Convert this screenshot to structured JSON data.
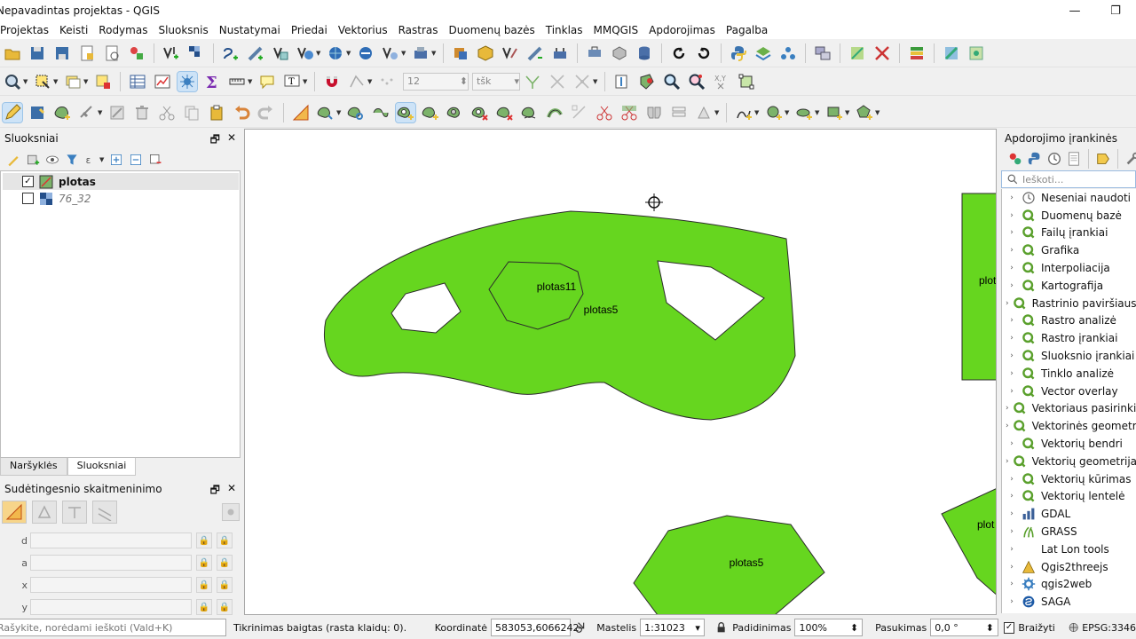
{
  "window": {
    "title": "Nepavadintas projektas - QGIS",
    "minimize": "—",
    "maximize": "❐"
  },
  "menu": [
    "Projektas",
    "Keisti",
    "Rodymas",
    "Sluoksnis",
    "Nustatymai",
    "Priedai",
    "Vektorius",
    "Rastras",
    "Duomenų bazės",
    "Tinklas",
    "MMQGIS",
    "Apdorojimas",
    "Pagalba"
  ],
  "toolbar2": {
    "snap_tolerance": "12",
    "snap_units": "tšk"
  },
  "layers_panel": {
    "title": "Sluoksniai",
    "float_icon": "🗗",
    "close_icon": "✕",
    "layers": [
      {
        "name": "plotas",
        "checked": "✓",
        "icon": "polygon-layer-icon"
      },
      {
        "name": "76_32",
        "checked": "",
        "icon": "raster-layer-icon"
      }
    ],
    "tabs": [
      "Naršyklės",
      "Sluoksniai"
    ]
  },
  "advanced_panel": {
    "title": "Sudėtingesnio skaitmeninimo",
    "rows": [
      {
        "label": "d"
      },
      {
        "label": "a"
      },
      {
        "label": "x"
      },
      {
        "label": "y"
      }
    ],
    "lock": "🔒"
  },
  "map": {
    "labels": [
      {
        "text": "plotas11"
      },
      {
        "text": "plotas5"
      },
      {
        "text": "plotas5"
      },
      {
        "text": "plot"
      },
      {
        "text": "plot"
      }
    ],
    "fill_color": "#66d61f",
    "stroke_color": "#2b2b2b"
  },
  "processing_panel": {
    "title": "Apdorojimo įrankinės",
    "search_placeholder": "Ieškoti...",
    "groups": [
      {
        "label": "Neseniai naudoti",
        "icon": "clock-icon"
      },
      {
        "label": "Duomenų bazė",
        "icon": "qgis-icon"
      },
      {
        "label": "Failų įrankiai",
        "icon": "qgis-icon"
      },
      {
        "label": "Grafika",
        "icon": "qgis-icon"
      },
      {
        "label": "Interpoliacija",
        "icon": "qgis-icon"
      },
      {
        "label": "Kartografija",
        "icon": "qgis-icon"
      },
      {
        "label": "Rastrinio paviršiaus a",
        "icon": "qgis-icon"
      },
      {
        "label": "Rastro analizė",
        "icon": "qgis-icon"
      },
      {
        "label": "Rastro įrankiai",
        "icon": "qgis-icon"
      },
      {
        "label": "Sluoksnio įrankiai",
        "icon": "qgis-icon"
      },
      {
        "label": "Tinklo analizė",
        "icon": "qgis-icon"
      },
      {
        "label": "Vector overlay",
        "icon": "qgis-icon"
      },
      {
        "label": "Vektoriaus pasirinkim",
        "icon": "qgis-icon"
      },
      {
        "label": "Vektorinės geometrij",
        "icon": "qgis-icon"
      },
      {
        "label": "Vektorių bendri",
        "icon": "qgis-icon"
      },
      {
        "label": "Vektorių geometrija",
        "icon": "qgis-icon"
      },
      {
        "label": "Vektorių kūrimas",
        "icon": "qgis-icon"
      },
      {
        "label": "Vektorių lentelė",
        "icon": "qgis-icon"
      },
      {
        "label": "GDAL",
        "icon": "gdal-icon"
      },
      {
        "label": "GRASS",
        "icon": "grass-icon"
      },
      {
        "label": "Lat Lon tools",
        "icon": "blank-icon"
      },
      {
        "label": "Qgis2threejs",
        "icon": "threejs-icon"
      },
      {
        "label": "qgis2web",
        "icon": "gear-icon"
      },
      {
        "label": "SAGA",
        "icon": "saga-icon"
      }
    ]
  },
  "status": {
    "search_placeholder": "Rašykite, norėdami ieškoti (Vald+K)",
    "message": "Tikrinimas baigtas (rasta klaidų: 0).",
    "coord_label": "Koordinatė",
    "coord_value": "583053,6066242",
    "scale_label": "Mastelis",
    "scale_value": "1:31023",
    "magnifier_label": "Padidinimas",
    "magnifier_value": "100%",
    "rotation_label": "Pasukimas",
    "rotation_value": "0,0 °",
    "render_label": "Braižyti",
    "render_checked": "✓",
    "crs_value": "EPSG:3346"
  }
}
